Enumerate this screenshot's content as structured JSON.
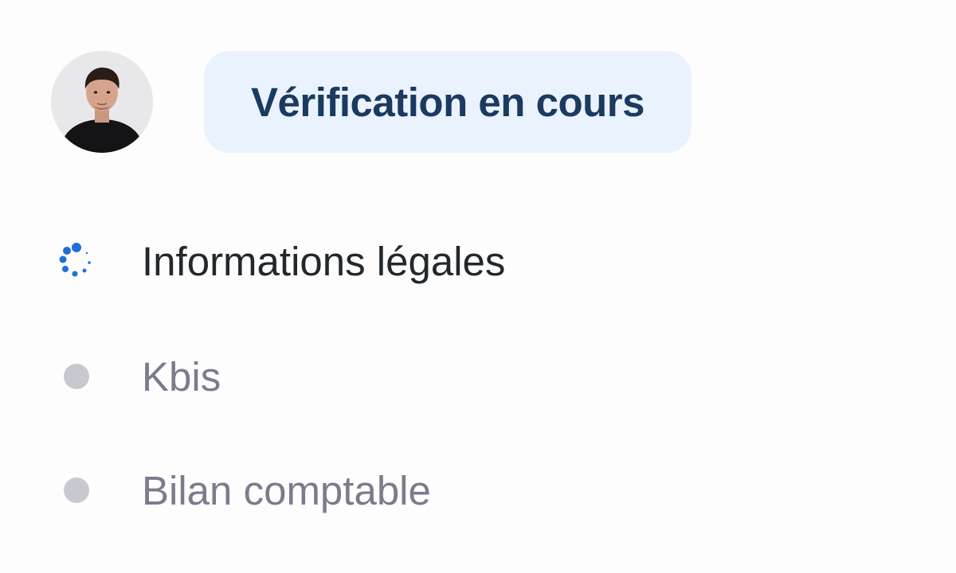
{
  "status": {
    "label": "Vérification en cours"
  },
  "steps": [
    {
      "label": "Informations légales",
      "state": "in-progress",
      "icon": "spinner-icon"
    },
    {
      "label": "Kbis",
      "state": "pending",
      "icon": "pending-dot-icon"
    },
    {
      "label": "Bilan comptable",
      "state": "pending",
      "icon": "pending-dot-icon"
    }
  ],
  "colors": {
    "spinner": "#1E6FD9",
    "pill_background": "#EAF2FE",
    "pill_text": "#1B3A5F",
    "active_text": "#22282B",
    "pending_text": "#7B7B8E",
    "pending_dot": "#C8C8CF"
  }
}
